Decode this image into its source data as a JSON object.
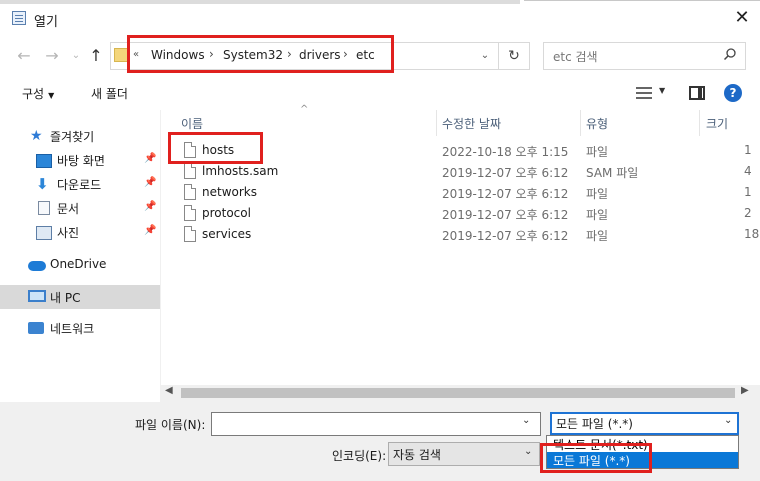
{
  "window": {
    "title": "열기",
    "close_glyph": "✕"
  },
  "nav": {
    "back_glyph": "←",
    "forward_glyph": "→",
    "recent_glyph": "⌄",
    "up_glyph": "↑",
    "address_overflow": "«",
    "breadcrumbs": [
      "Windows",
      "System32",
      "drivers",
      "etc"
    ],
    "crumb_sep": "›",
    "refresh_glyph": "↻",
    "search_placeholder": "etc 검색"
  },
  "toolbar": {
    "organize": "구성",
    "new_folder": "새 폴더",
    "help": "?"
  },
  "sidebar": {
    "items": [
      {
        "label": "즐겨찾기"
      },
      {
        "label": "바탕 화면"
      },
      {
        "label": "다운로드"
      },
      {
        "label": "문서"
      },
      {
        "label": "사진"
      },
      {
        "label": "OneDrive"
      },
      {
        "label": "내 PC"
      },
      {
        "label": "네트워크"
      }
    ]
  },
  "file_list": {
    "columns": [
      "이름",
      "수정한 날짜",
      "유형",
      "크기"
    ],
    "rows": [
      {
        "name": "hosts",
        "date": "2022-10-18 오후 1:15",
        "type": "파일",
        "size": "1"
      },
      {
        "name": "lmhosts.sam",
        "date": "2019-12-07 오후 6:12",
        "type": "SAM 파일",
        "size": "4"
      },
      {
        "name": "networks",
        "date": "2019-12-07 오후 6:12",
        "type": "파일",
        "size": "1"
      },
      {
        "name": "protocol",
        "date": "2019-12-07 오후 6:12",
        "type": "파일",
        "size": "2"
      },
      {
        "name": "services",
        "date": "2019-12-07 오후 6:12",
        "type": "파일",
        "size": "18"
      }
    ]
  },
  "bottom": {
    "filename_label": "파일 이름(N):",
    "filename_value": "",
    "filetype_value": "모든 파일 (*.*)",
    "filetype_options": [
      "텍스트 문서(*.txt)",
      "모든 파일 (*.*)"
    ],
    "encoding_label": "인코딩(E):",
    "encoding_value": "자동 검색"
  },
  "colors": {
    "accent": "#0a78d7",
    "highlight_box": "#e0201e",
    "selected_sidebar": "#d9d9d9"
  }
}
